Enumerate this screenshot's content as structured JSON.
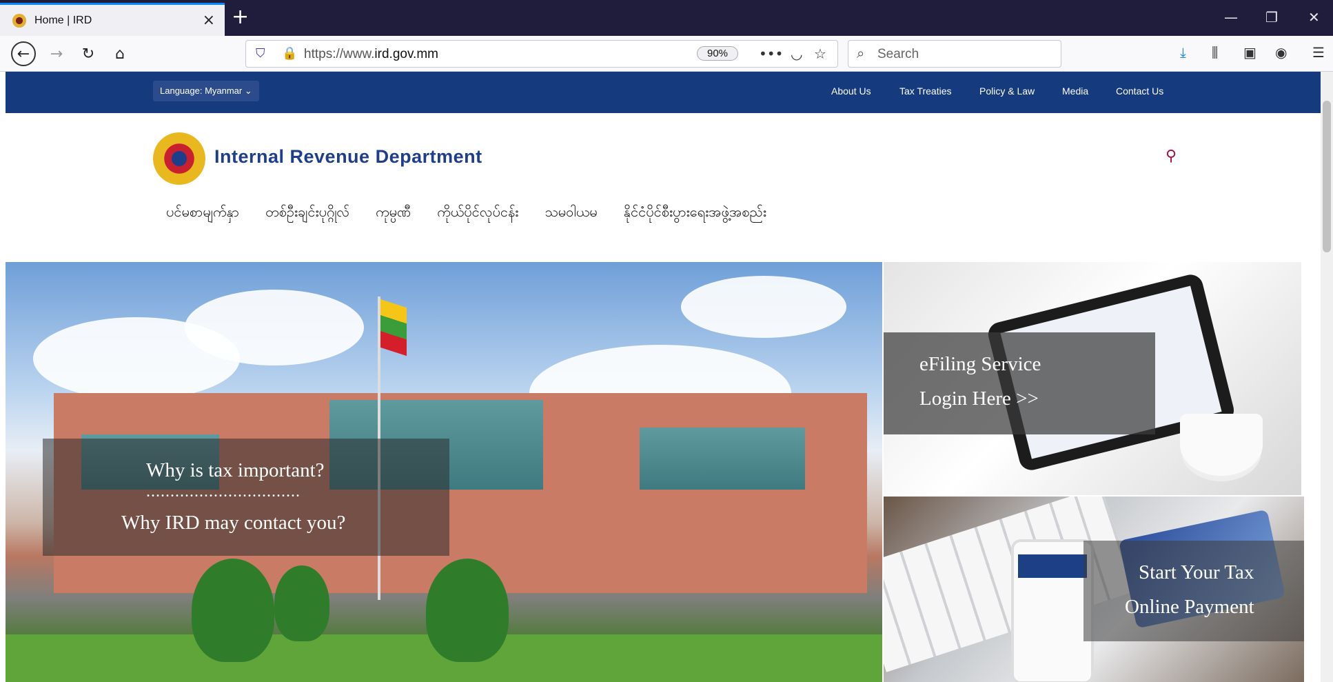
{
  "browser": {
    "tab_title": "Home | IRD",
    "tab_close": "×",
    "new_tab": "+",
    "url_prefix": "https://www.",
    "url_domain": "ird.gov.mm",
    "zoom": "90%",
    "page_actions": "•••",
    "search_placeholder": "Search",
    "window_minimize": "—",
    "window_restore": "❐",
    "window_close": "✕"
  },
  "site": {
    "language_label": "Language: Myanmar ⌄",
    "top_links": [
      "About Us",
      "Tax Treaties",
      "Policy & Law",
      "Media",
      "Contact Us"
    ],
    "brand": "Internal Revenue Department",
    "main_menu": [
      "ပင်မစာမျက်နှာ",
      "တစ်ဦးချင်းပုဂ္ဂိုလ်",
      "ကုမ္ပဏီ",
      "ကိုယ်ပိုင်လုပ်ငန်း",
      "သမဝါယမ",
      "နိုင်ငံပိုင်စီးပွားရေးအဖွဲ့အစည်း"
    ]
  },
  "banners": {
    "hero": {
      "line1": "Why is tax important?",
      "dots": "................................",
      "line2": "Why IRD may contact you?"
    },
    "efiling": {
      "line1": "eFiling Service",
      "line2": "Login Here >>"
    },
    "payment": {
      "line1": "Start Your Tax",
      "line2": "Online Payment"
    }
  },
  "colors": {
    "topbar": "#163a7e",
    "brand_text": "#1e3d8b",
    "search_accent": "#a4123f",
    "browser_tab_strip": "#1f1d3b"
  }
}
